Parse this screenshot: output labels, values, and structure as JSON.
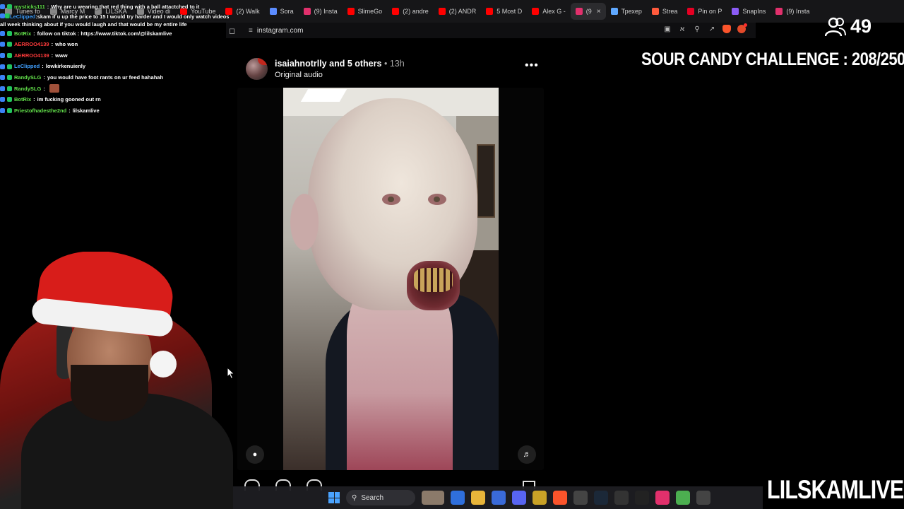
{
  "browser": {
    "tabs": [
      {
        "label": "Tunes fo",
        "color": "#888888"
      },
      {
        "label": "Marcy M",
        "color": "#888888"
      },
      {
        "label": "LILSKA",
        "color": "#888888"
      },
      {
        "label": "Video di",
        "color": "#888888"
      },
      {
        "label": "YouTube",
        "color": "#ff0000"
      },
      {
        "label": "(2) Walk",
        "color": "#ff0000"
      },
      {
        "label": "Sora",
        "color": "#5b8cff"
      },
      {
        "label": "(9) Insta",
        "color": "#e1306c"
      },
      {
        "label": "SlimeGo",
        "color": "#ff0000"
      },
      {
        "label": "(2) andre",
        "color": "#ff0000"
      },
      {
        "label": "(2) ANDR",
        "color": "#ff0000"
      },
      {
        "label": "5 Most D",
        "color": "#ff0000"
      },
      {
        "label": "Alex G -",
        "color": "#ff0000"
      },
      {
        "label": "(9",
        "color": "#e1306c",
        "active": true
      },
      {
        "label": "Трехер",
        "color": "#5fa8ff"
      },
      {
        "label": "Strea",
        "color": "#ff5a3c"
      },
      {
        "label": "Pin on P",
        "color": "#e60023"
      },
      {
        "label": "SnapIns",
        "color": "#8b5cf6"
      },
      {
        "label": "(9) Insta",
        "color": "#e1306c"
      }
    ],
    "close_tab_glyph": "×",
    "url": "instagram.com"
  },
  "stream": {
    "viewer_count": "49",
    "challenge_text": "SOUR CANDY CHALLENGE : 208/250",
    "brand_text": "LILSKAMLIVE"
  },
  "chat": [
    {
      "user": "mysticks111",
      "user_color": "#63e24b",
      "text": "Why are u wearing that red thing with a ball attactched to it"
    },
    {
      "user": "LeClipped",
      "user_color": "#40a0ff",
      "text": "skam if u up the price to 15 I would try harder and I would only watch videos all week thinking about if you would laugh and that would be my entire life",
      "wrap": true
    },
    {
      "user": "BotRix",
      "user_color": "#63e24b",
      "text": "follow on tiktok : https://www.tiktok.com/@lilskamlive"
    },
    {
      "user": "AERROO4139",
      "user_color": "#ff3b3b",
      "text": "who won"
    },
    {
      "user": "AERROO4139",
      "user_color": "#ff3b3b",
      "text": "www"
    },
    {
      "user": "LeClipped",
      "user_color": "#40a0ff",
      "text": "lowkirkenuienly"
    },
    {
      "user": "RandySLG",
      "user_color": "#63e24b",
      "text": "you would have foot rants on ur feed hahahah"
    },
    {
      "user": "RandySLG",
      "user_color": "#63e24b",
      "text": "",
      "emote": true
    },
    {
      "user": "BotRix",
      "user_color": "#63e24b",
      "text": "im fucking gooned out rn"
    },
    {
      "user": "Priestofhadesthe2nd",
      "user_color": "#63e24b",
      "text": "lilskamlive"
    }
  ],
  "post": {
    "author": "isaiahnotrlly",
    "coauthors": "and 5 others",
    "separator": "•",
    "time": "13h",
    "audio": "Original audio"
  },
  "taskbar": {
    "search_label": "Search"
  }
}
